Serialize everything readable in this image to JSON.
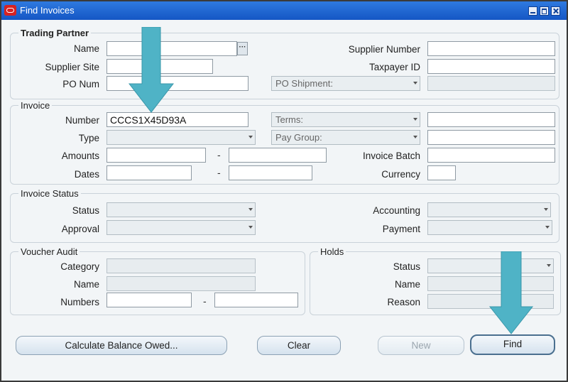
{
  "window": {
    "title": "Find Invoices"
  },
  "trading_partner": {
    "heading": "Trading Partner",
    "name_label": "Name",
    "supplier_site_label": "Supplier Site",
    "po_num_label": "PO Num",
    "supplier_number_label": "Supplier Number",
    "taxpayer_id_label": "Taxpayer ID",
    "po_shipment_placeholder": "PO Shipment:",
    "lov_glyph": "···"
  },
  "invoice": {
    "heading": "Invoice",
    "number_label": "Number",
    "number_value": "CCCS1X45D93A",
    "type_label": "Type",
    "amounts_label": "Amounts",
    "dates_label": "Dates",
    "terms_placeholder": "Terms:",
    "pay_group_placeholder": "Pay Group:",
    "invoice_batch_label": "Invoice Batch",
    "currency_label": "Currency",
    "range_separator": "-"
  },
  "invoice_status": {
    "heading": "Invoice Status",
    "status_label": "Status",
    "approval_label": "Approval",
    "accounting_label": "Accounting",
    "payment_label": "Payment"
  },
  "voucher_audit": {
    "heading": "Voucher Audit",
    "category_label": "Category",
    "name_label": "Name",
    "numbers_label": "Numbers",
    "range_separator": "-"
  },
  "holds": {
    "heading": "Holds",
    "status_label": "Status",
    "name_label": "Name",
    "reason_label": "Reason"
  },
  "buttons": {
    "calculate": "Calculate Balance Owed...",
    "clear": "Clear",
    "new": "New",
    "find": "Find"
  },
  "colors": {
    "titlebar": "#1f66d2",
    "annotation_arrow": "#4fb3c6",
    "panel_background": "#f2f5f7"
  }
}
